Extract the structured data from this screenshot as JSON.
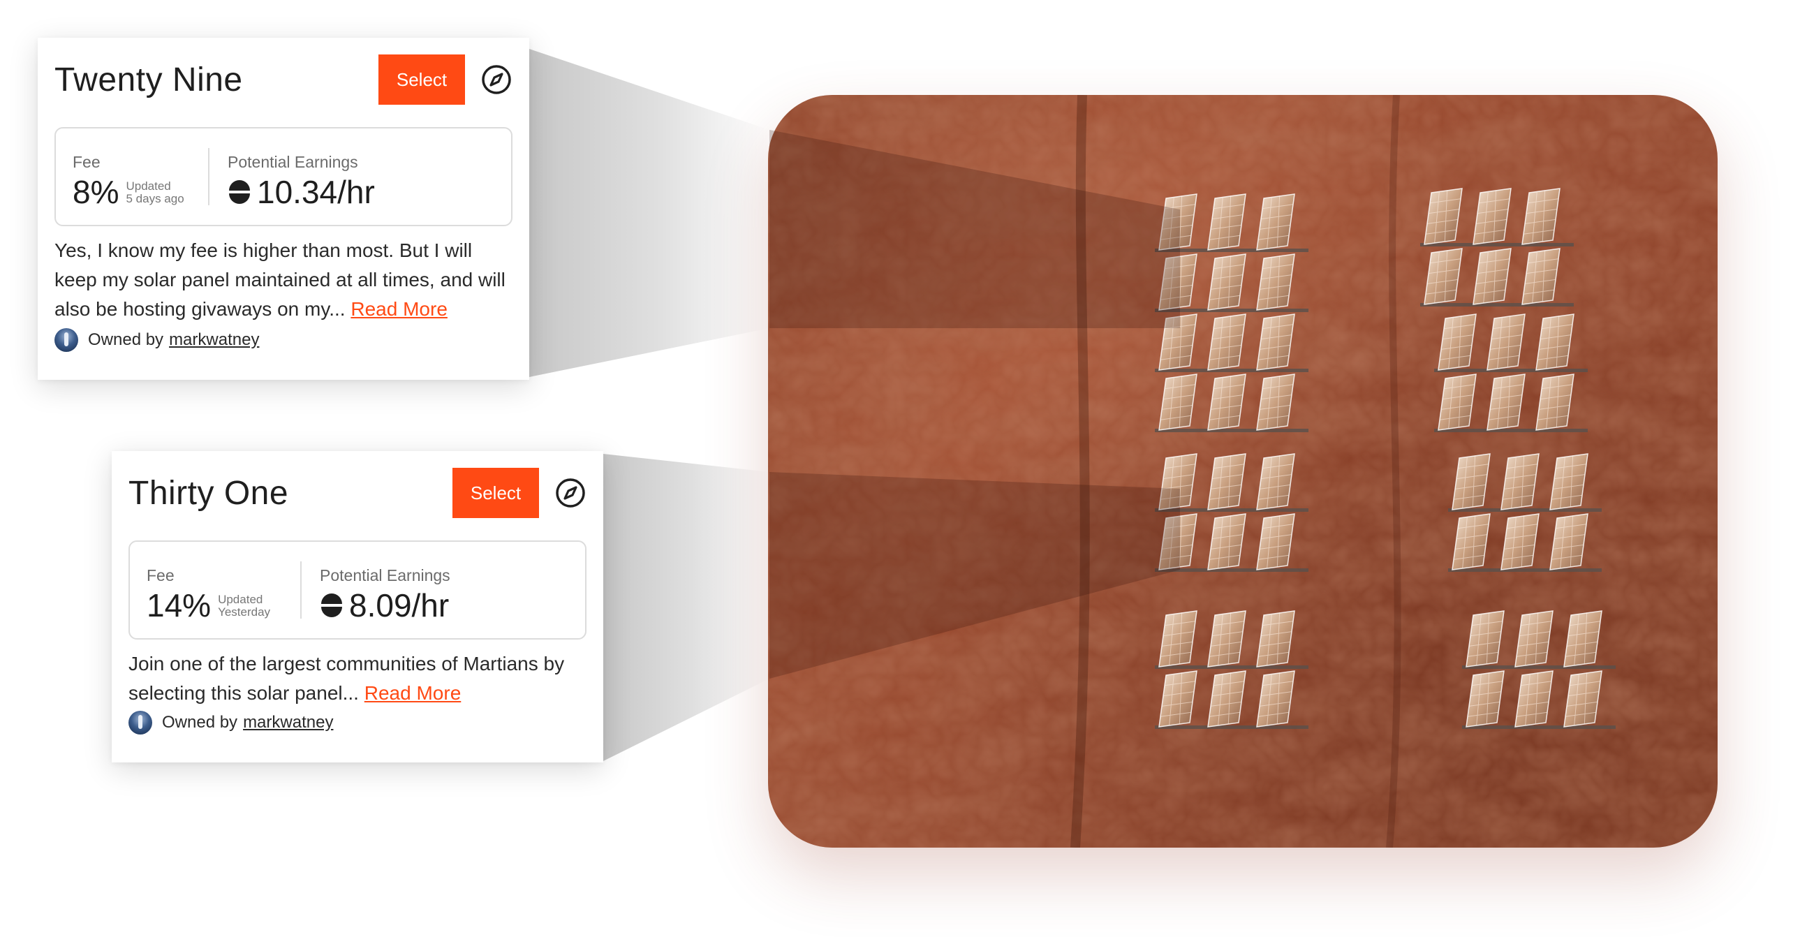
{
  "colors": {
    "accent": "#ff4a14",
    "terrain": "#8e4128",
    "text": "#1f1f1f"
  },
  "cards": [
    {
      "title": "Twenty Nine",
      "select_label": "Select",
      "fee_label": "Fee",
      "fee_value": "8%",
      "updated_label": "Updated",
      "updated_when": "5 days ago",
      "earnings_label": "Potential Earnings",
      "earnings_value": "10.34/hr",
      "description": "Yes, I know my fee is higher than most. But I will keep my solar panel maintained at all times, and will also be hosting givaways on my...",
      "read_more": "Read More",
      "owned_by_label": "Owned by",
      "owner": "markwatney",
      "icons": {
        "compass": "compass-icon",
        "coin": "coin-icon",
        "avatar": "avatar"
      }
    },
    {
      "title": "Thirty One",
      "select_label": "Select",
      "fee_label": "Fee",
      "fee_value": "14%",
      "updated_label": "Updated",
      "updated_when": "Yesterday",
      "earnings_label": "Potential Earnings",
      "earnings_value": "8.09/hr",
      "description": "Join one of the largest communities of Martians by selecting this solar panel...",
      "read_more": "Read More",
      "owned_by_label": "Owned by",
      "owner": "markwatney",
      "icons": {
        "compass": "compass-icon",
        "coin": "coin-icon",
        "avatar": "avatar"
      }
    }
  ],
  "terrain": {
    "description_icon": "solar-panel-grid",
    "panel_clusters": 8,
    "panels_per_cluster": 6
  }
}
